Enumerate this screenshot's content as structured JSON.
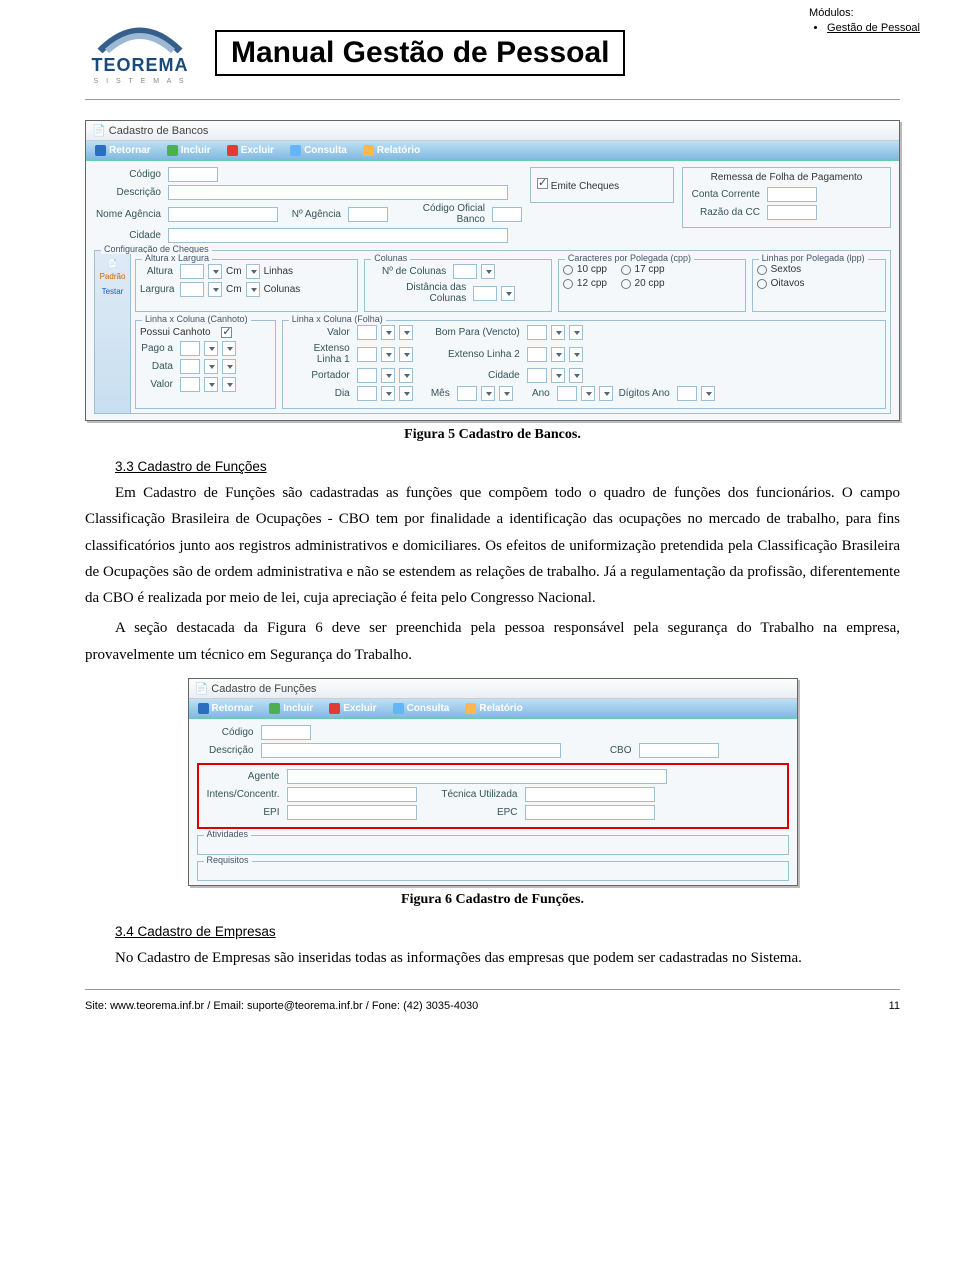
{
  "header": {
    "logo_name": "TEOREMA",
    "logo_sub": "S I S T E M A S",
    "title": "Manual Gestão de Pessoal",
    "modulos_label": "Módulos:",
    "modulos_item": "Gestão de Pessoal"
  },
  "app1": {
    "window_title": "Cadastro de Bancos",
    "toolbar": {
      "retornar": "Retornar",
      "incluir": "Incluir",
      "excluir": "Excluir",
      "consulta": "Consulta",
      "relatorio": "Relatório"
    },
    "fields": {
      "codigo": "Código",
      "descricao": "Descrição",
      "nome_agencia": "Nome Agência",
      "no_agencia": "Nº Agência",
      "cod_oficial": "Código Oficial Banco",
      "cidade": "Cidade",
      "emite_cheques": "Emite Cheques",
      "remessa": "Remessa de Folha de Pagamento",
      "conta_corrente": "Conta Corrente",
      "razao_cc": "Razão da CC",
      "config_cheques": "Configuração de Cheques",
      "altura_largura": "Altura x Largura",
      "altura": "Altura",
      "largura": "Largura",
      "cm": "Cm",
      "linhas": "Linhas",
      "colunas_h": "Colunas",
      "colunas": "Colunas",
      "no_colunas": "Nº de Colunas",
      "dist_colunas": "Distância das Colunas",
      "cpp": "Caracteres por Polegada (cpp)",
      "c10": "10 cpp",
      "c12": "12 cpp",
      "c17": "17 cpp",
      "c20": "20 cpp",
      "lpp": "Linhas por Polegada (lpp)",
      "sextos": "Sextos",
      "oitavos": "Oitavos",
      "lxc_canhoto": "Linha x Coluna (Canhoto)",
      "lxc_folha": "Linha x Coluna (Folha)",
      "possui_canhoto": "Possui Canhoto",
      "valor": "Valor",
      "bom_para": "Bom Para (Vencto)",
      "pago_a": "Pago a",
      "ext_l1": "Extenso Linha 1",
      "ext_l2": "Extenso Linha 2",
      "data": "Data",
      "portador": "Portador",
      "dia": "Dia",
      "mes": "Mês",
      "ano": "Ano",
      "dig_ano": "Dígitos Ano",
      "tab_padrao": "Padrão",
      "tab_testar": "Testar"
    }
  },
  "caption1": "Figura 5 Cadastro de Bancos.",
  "section1_title": "3.3 Cadastro de Funções",
  "para1": "Em Cadastro de Funções são cadastradas as funções que compõem todo o quadro de funções dos funcionários. O campo Classificação Brasileira de Ocupações - CBO tem por finalidade a identificação das ocupações no mercado de trabalho, para fins classificatórios junto aos registros administrativos e domiciliares. Os efeitos de uniformização pretendida pela Classificação Brasileira de Ocupações são de ordem administrativa e não se estendem as relações de trabalho. Já a regulamentação da profissão, diferentemente da CBO é realizada por meio de lei, cuja apreciação é feita pelo Congresso Nacional.",
  "para2": "A seção destacada da Figura 6 deve ser preenchida pela pessoa responsável pela segurança do Trabalho na empresa, provavelmente um técnico em Segurança do Trabalho.",
  "app2": {
    "window_title": "Cadastro de Funções",
    "toolbar": {
      "retornar": "Retornar",
      "incluir": "Incluir",
      "excluir": "Excluir",
      "consulta": "Consulta",
      "relatorio": "Relatório"
    },
    "fields": {
      "codigo": "Código",
      "descricao": "Descrição",
      "cbo": "CBO",
      "agente": "Agente",
      "intens": "Intens/Concentr.",
      "tecnica": "Técnica Utilizada",
      "epi": "EPI",
      "epc": "EPC",
      "atividades": "Atividades",
      "requisitos": "Requisitos"
    }
  },
  "caption2": "Figura 6 Cadastro de Funções.",
  "section2_title": "3.4 Cadastro de Empresas",
  "para3": "No Cadastro de Empresas são inseridas todas as informações das empresas que podem ser cadastradas no Sistema.",
  "footer": {
    "left": "Site: www.teorema.inf.br / Email: suporte@teorema.inf.br / Fone: (42) 3035-4030",
    "page": "11"
  }
}
